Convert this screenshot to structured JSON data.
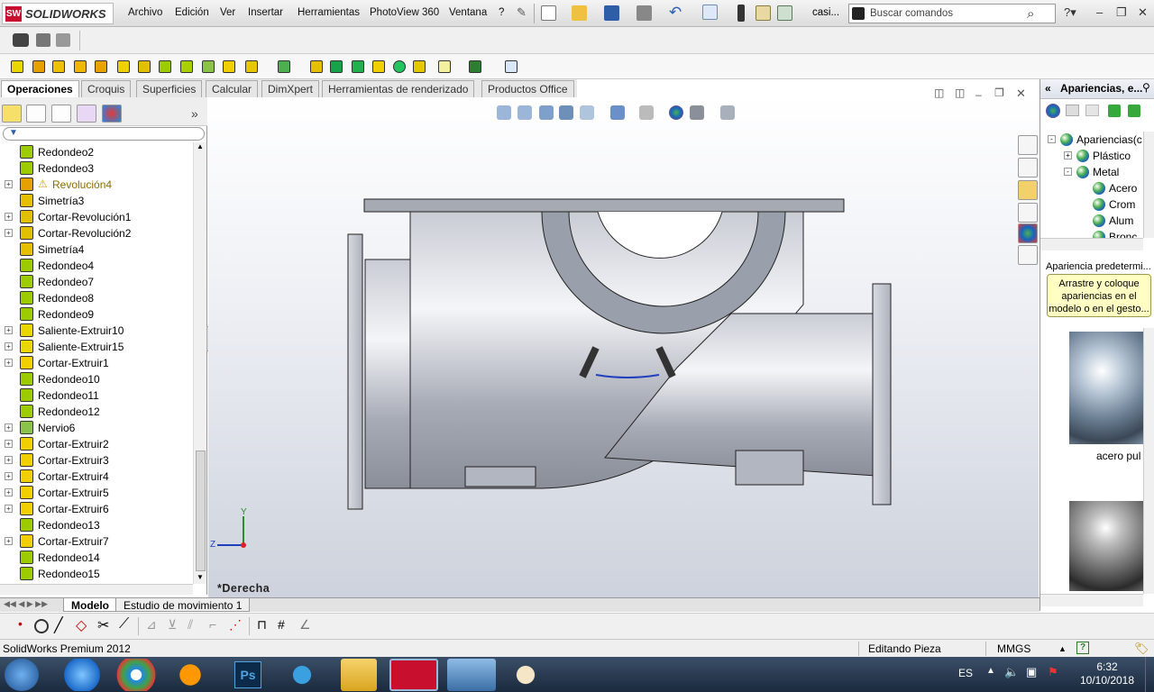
{
  "app": {
    "brand": "SOLIDWORKS",
    "brand_mark": "SW"
  },
  "menu": [
    "Archivo",
    "Edición",
    "Ver",
    "Insertar",
    "Herramientas",
    "PhotoView 360",
    "Ventana",
    "?"
  ],
  "title": "casi...",
  "search": {
    "placeholder": "Buscar comandos"
  },
  "command_tabs": [
    "Operaciones",
    "Croquis",
    "Superficies",
    "Calcular",
    "DimXpert",
    "Herramientas de renderizado",
    "Productos Office"
  ],
  "feature_tree": [
    {
      "label": "Redondeo2",
      "icon": "fillet-icon",
      "expand": false
    },
    {
      "label": "Redondeo3",
      "icon": "fillet-icon",
      "expand": false
    },
    {
      "label": "Revolución4",
      "icon": "revolve-icon",
      "expand": true,
      "warning": true
    },
    {
      "label": "Simetría3",
      "icon": "mirror-icon",
      "expand": false
    },
    {
      "label": "Cortar-Revolución1",
      "icon": "cut-revolve-icon",
      "expand": true
    },
    {
      "label": "Cortar-Revolución2",
      "icon": "cut-revolve-icon",
      "expand": true
    },
    {
      "label": "Simetría4",
      "icon": "mirror-icon",
      "expand": false
    },
    {
      "label": "Redondeo4",
      "icon": "fillet-icon",
      "expand": false
    },
    {
      "label": "Redondeo7",
      "icon": "fillet-icon",
      "expand": false
    },
    {
      "label": "Redondeo8",
      "icon": "fillet-icon",
      "expand": false
    },
    {
      "label": "Redondeo9",
      "icon": "fillet-icon",
      "expand": false
    },
    {
      "label": "Saliente-Extruir10",
      "icon": "extrude-boss-icon",
      "expand": true
    },
    {
      "label": "Saliente-Extruir15",
      "icon": "extrude-boss-icon",
      "expand": true
    },
    {
      "label": "Cortar-Extruir1",
      "icon": "extrude-cut-icon",
      "expand": true
    },
    {
      "label": "Redondeo10",
      "icon": "fillet-icon",
      "expand": false
    },
    {
      "label": "Redondeo11",
      "icon": "fillet-icon",
      "expand": false
    },
    {
      "label": "Redondeo12",
      "icon": "fillet-icon",
      "expand": false
    },
    {
      "label": "Nervio6",
      "icon": "rib-icon",
      "expand": true
    },
    {
      "label": "Cortar-Extruir2",
      "icon": "extrude-cut-icon",
      "expand": true
    },
    {
      "label": "Cortar-Extruir3",
      "icon": "extrude-cut-icon",
      "expand": true
    },
    {
      "label": "Cortar-Extruir4",
      "icon": "extrude-cut-icon",
      "expand": true
    },
    {
      "label": "Cortar-Extruir5",
      "icon": "extrude-cut-icon",
      "expand": true
    },
    {
      "label": "Cortar-Extruir6",
      "icon": "extrude-cut-icon",
      "expand": true
    },
    {
      "label": "Redondeo13",
      "icon": "fillet-icon",
      "expand": false
    },
    {
      "label": "Cortar-Extruir7",
      "icon": "extrude-cut-icon",
      "expand": true
    },
    {
      "label": "Redondeo14",
      "icon": "fillet-icon",
      "expand": false
    },
    {
      "label": "Redondeo15",
      "icon": "fillet-icon",
      "expand": false
    }
  ],
  "viewport": {
    "view_name": "*Derecha",
    "triad_y": "Y",
    "triad_z": "Z"
  },
  "task_pane": {
    "title": "Apariencias, e...",
    "tree": [
      {
        "label": "Apariencias(c",
        "indent": 0,
        "expand": "-"
      },
      {
        "label": "Plástico",
        "indent": 1,
        "expand": "+"
      },
      {
        "label": "Metal",
        "indent": 1,
        "expand": "-"
      },
      {
        "label": "Acero",
        "indent": 2,
        "expand": ""
      },
      {
        "label": "Crom",
        "indent": 2,
        "expand": ""
      },
      {
        "label": "Alum",
        "indent": 2,
        "expand": ""
      },
      {
        "label": "Bronc",
        "indent": 2,
        "expand": ""
      }
    ],
    "preview_label": "Apariencia predetermi...",
    "tooltip": "Arrastre y coloque apariencias en el modelo o en el gesto...",
    "swatch1_label": "acero pul"
  },
  "bottom_tabs": [
    "Modelo",
    "Estudio de movimiento 1"
  ],
  "status": {
    "product": "SolidWorks Premium 2012",
    "mode": "Editando Pieza",
    "units": "MMGS"
  },
  "tray": {
    "language": "ES",
    "time": "6:32",
    "date": "10/10/2018"
  }
}
